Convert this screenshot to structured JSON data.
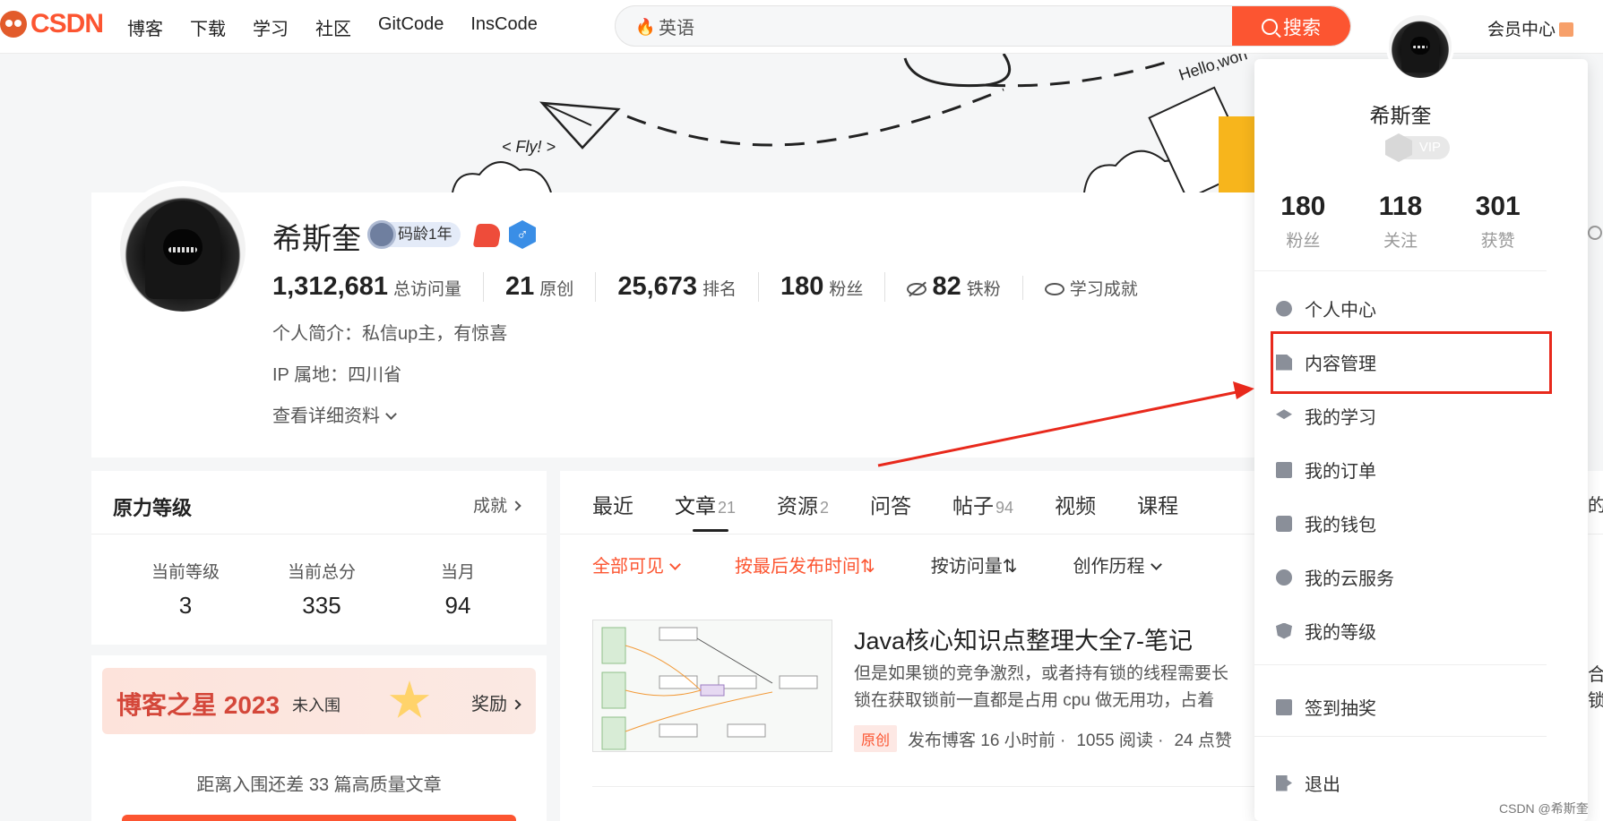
{
  "brand": {
    "logo_text": "CSDN",
    "accent": "#fc5531"
  },
  "nav": {
    "items": [
      "博客",
      "下载",
      "学习",
      "社区",
      "GitCode",
      "InsCode"
    ]
  },
  "search": {
    "value": "英语",
    "button_label": "搜索"
  },
  "member_center": "会员中心",
  "banner": {
    "fly_text": "< Fly! >",
    "hello_text": "Hello,worl"
  },
  "profile": {
    "name": "希斯奎",
    "code_age": "码龄1年",
    "stats": [
      {
        "value": "1,312,681",
        "label": "总访问量"
      },
      {
        "value": "21",
        "label": "原创"
      },
      {
        "value": "25,673",
        "label": "排名"
      },
      {
        "value": "180",
        "label": "粉丝"
      },
      {
        "value": "82",
        "label": "铁粉"
      }
    ],
    "achievement_label": "学习成就",
    "bio": "个人简介：私信up主，有惊喜",
    "ip": "IP 属地：四川省",
    "more": "查看详细资料"
  },
  "power": {
    "title": "原力等级",
    "link": "成就",
    "cols": [
      {
        "label": "当前等级",
        "value": "3"
      },
      {
        "label": "当前总分",
        "value": "335"
      },
      {
        "label": "当月",
        "value": "94"
      }
    ]
  },
  "blog_star": {
    "title": "博客之星 2023",
    "status": "未入围",
    "reward": "奖励",
    "note": "距离入围还差 33 篇高质量文章"
  },
  "tabs": [
    {
      "label": "最近",
      "count": ""
    },
    {
      "label": "文章",
      "count": "21"
    },
    {
      "label": "资源",
      "count": "2"
    },
    {
      "label": "问答",
      "count": ""
    },
    {
      "label": "帖子",
      "count": "94"
    },
    {
      "label": "视频",
      "count": ""
    },
    {
      "label": "课程",
      "count": ""
    }
  ],
  "filters": {
    "visibility": "全部可见",
    "sort_time": "按最后发布时间⇅",
    "sort_views": "按访问量⇅",
    "history": "创作历程"
  },
  "article": {
    "title": "Java核心知识点整理大全7-笔记",
    "desc1": "但是如果锁的竞争激烈，或者持有锁的线程需要长",
    "desc2": "锁在获取锁前一直都是占用 cpu 做无用功，占着",
    "tag": "原创",
    "published": "发布博客 16 小时前 ·",
    "reads": "1055 阅读 ·",
    "likes": "24 点赞"
  },
  "edge": {
    "e1": "的",
    "e2": "合",
    "e3": "锁"
  },
  "dropdown": {
    "name": "希斯奎",
    "vip": "VIP",
    "stats": [
      {
        "value": "180",
        "label": "粉丝"
      },
      {
        "value": "118",
        "label": "关注"
      },
      {
        "value": "301",
        "label": "获赞"
      }
    ],
    "menu": [
      "个人中心",
      "内容管理",
      "我的学习",
      "我的订单",
      "我的钱包",
      "我的云服务",
      "我的等级"
    ],
    "sign_in": "签到抽奖",
    "logout": "退出"
  },
  "watermark": "CSDN @希斯奎"
}
